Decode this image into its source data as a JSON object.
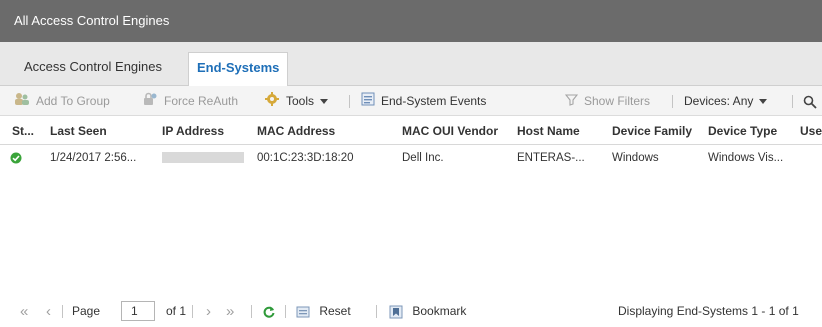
{
  "window": {
    "title": "All Access Control Engines"
  },
  "tabs": [
    {
      "label": "Access Control Engines"
    },
    {
      "label": "End-Systems"
    }
  ],
  "toolbar": {
    "add_to_group": "Add To Group",
    "force_reauth": "Force ReAuth",
    "tools": "Tools",
    "end_system_events": "End-System Events",
    "show_filters": "Show Filters",
    "devices": "Devices: Any"
  },
  "table": {
    "columns": [
      "St...",
      "Last Seen",
      "IP Address",
      "MAC Address",
      "MAC OUI Vendor",
      "Host Name",
      "Device Family",
      "Device Type",
      "Use"
    ],
    "rows": [
      {
        "last_seen": "1/24/2017 2:56...",
        "mac": "00:1C:23:3D:18:20",
        "vendor": "Dell Inc.",
        "host": "ENTERAS-...",
        "family": "Windows",
        "type": "Windows Vis..."
      }
    ]
  },
  "pager": {
    "page_label": "Page",
    "page_value": "1",
    "of_label": "of 1",
    "reset": "Reset",
    "bookmark": "Bookmark",
    "status": "Displaying End-Systems 1 - 1 of 1"
  },
  "colors": {
    "titlebar": "#6b6b6b",
    "accent": "#1e6fb8",
    "status_ok": "#3aa43a"
  }
}
